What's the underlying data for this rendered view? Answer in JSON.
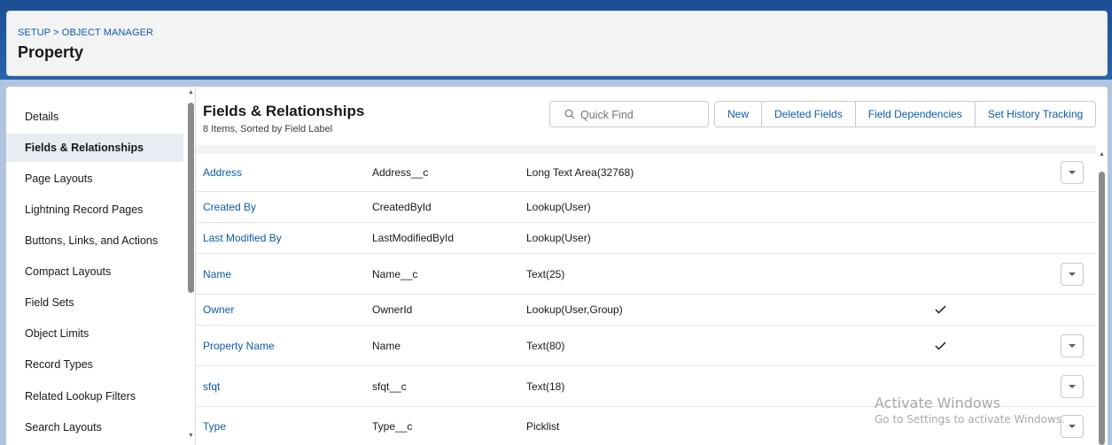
{
  "header": {
    "breadcrumb": "SETUP > OBJECT MANAGER",
    "title": "Property"
  },
  "sidebar": {
    "items": [
      {
        "label": "Details",
        "active": false
      },
      {
        "label": "Fields & Relationships",
        "active": true
      },
      {
        "label": "Page Layouts",
        "active": false
      },
      {
        "label": "Lightning Record Pages",
        "active": false
      },
      {
        "label": "Buttons, Links, and Actions",
        "active": false
      },
      {
        "label": "Compact Layouts",
        "active": false
      },
      {
        "label": "Field Sets",
        "active": false
      },
      {
        "label": "Object Limits",
        "active": false
      },
      {
        "label": "Record Types",
        "active": false
      },
      {
        "label": "Related Lookup Filters",
        "active": false
      },
      {
        "label": "Search Layouts",
        "active": false
      }
    ]
  },
  "main": {
    "title": "Fields & Relationships",
    "subtitle": "8 Items, Sorted by Field Label",
    "quick_find": {
      "placeholder": "Quick Find",
      "value": ""
    },
    "buttons": [
      "New",
      "Deleted Fields",
      "Field Dependencies",
      "Set History Tracking"
    ],
    "rows": [
      {
        "label": "Address",
        "api": "Address__c",
        "type": "Long Text Area(32768)",
        "indexed": false,
        "has_action": true
      },
      {
        "label": "Created By",
        "api": "CreatedById",
        "type": "Lookup(User)",
        "indexed": false,
        "has_action": false
      },
      {
        "label": "Last Modified By",
        "api": "LastModifiedById",
        "type": "Lookup(User)",
        "indexed": false,
        "has_action": false
      },
      {
        "label": "Name",
        "api": "Name__c",
        "type": "Text(25)",
        "indexed": false,
        "has_action": true
      },
      {
        "label": "Owner",
        "api": "OwnerId",
        "type": "Lookup(User,Group)",
        "indexed": true,
        "has_action": false
      },
      {
        "label": "Property Name",
        "api": "Name",
        "type": "Text(80)",
        "indexed": true,
        "has_action": true
      },
      {
        "label": "sfqt",
        "api": "sfqt__c",
        "type": "Text(18)",
        "indexed": false,
        "has_action": true
      },
      {
        "label": "Type",
        "api": "Type__c",
        "type": "Picklist",
        "indexed": false,
        "has_action": true
      }
    ]
  },
  "watermark": {
    "title": "Activate Windows",
    "subtitle": "Go to Settings to activate Windows."
  },
  "colors": {
    "link": "#0b5cab",
    "active_nav_bg": "#e8edf3",
    "header_bg": "#f3f3f3",
    "brand_band": "#1b5297"
  },
  "icons": {
    "search": "search-icon",
    "row_action": "chevron-down-icon",
    "indexed": "checkmark-icon"
  }
}
